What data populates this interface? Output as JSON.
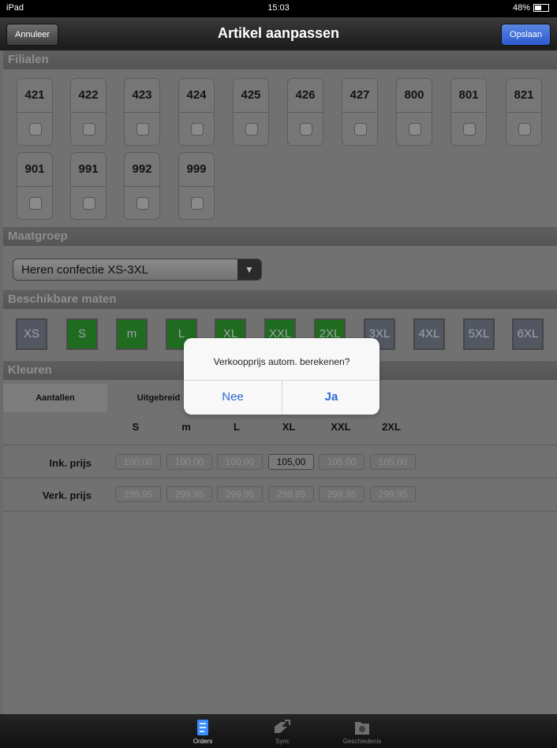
{
  "status": {
    "device": "iPad",
    "time": "15:03",
    "battery": "48%"
  },
  "nav": {
    "cancel": "Annuleer",
    "title": "Artikel aanpassen",
    "save": "Opslaan"
  },
  "sections": {
    "branches": "Filialen",
    "size_group": "Maatgroep",
    "available_sizes": "Beschikbare maten",
    "colors": "Kleuren"
  },
  "branches": [
    "421",
    "422",
    "423",
    "424",
    "425",
    "426",
    "427",
    "800",
    "801",
    "821",
    "901",
    "991",
    "992",
    "999"
  ],
  "size_group": {
    "value": "Heren confectie XS-3XL"
  },
  "sizes": [
    {
      "label": "XS",
      "selected": false
    },
    {
      "label": "S",
      "selected": true
    },
    {
      "label": "m",
      "selected": true
    },
    {
      "label": "L",
      "selected": true
    },
    {
      "label": "XL",
      "selected": true
    },
    {
      "label": "XXL",
      "selected": true
    },
    {
      "label": "2XL",
      "selected": true
    },
    {
      "label": "3XL",
      "selected": false
    },
    {
      "label": "4XL",
      "selected": false
    },
    {
      "label": "5XL",
      "selected": false
    },
    {
      "label": "6XL",
      "selected": false
    }
  ],
  "tabs": {
    "quantities": "Aantallen",
    "extended": "Uitgebreid"
  },
  "columns": [
    "S",
    "m",
    "L",
    "XL",
    "XXL",
    "2XL"
  ],
  "purchase": {
    "label": "Ink. prijs",
    "values": [
      "100,00",
      "100,00",
      "100,00",
      "105,00",
      "105,00",
      "105,00"
    ]
  },
  "sale": {
    "label": "Verk. prijs",
    "values": [
      "299,95",
      "299,95",
      "299,95",
      "299,95",
      "299,95",
      "299,95"
    ]
  },
  "alert": {
    "message": "Verkoopprijs autom. berekenen?",
    "no": "Nee",
    "yes": "Ja"
  },
  "tabbar": {
    "orders": "Orders",
    "sync": "Sync",
    "history": "Geschiedenis"
  },
  "colors": {
    "accent": "#2a68d3",
    "selected_size": "#1f6b1f"
  }
}
